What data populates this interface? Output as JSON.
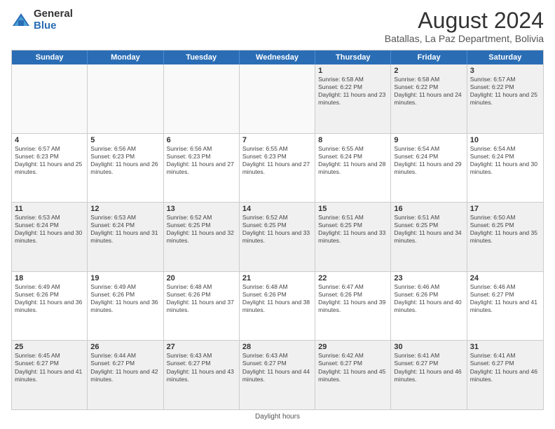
{
  "logo": {
    "general": "General",
    "blue": "Blue"
  },
  "title": "August 2024",
  "subtitle": "Batallas, La Paz Department, Bolivia",
  "days": [
    "Sunday",
    "Monday",
    "Tuesday",
    "Wednesday",
    "Thursday",
    "Friday",
    "Saturday"
  ],
  "weeks": [
    [
      {
        "day": "",
        "content": ""
      },
      {
        "day": "",
        "content": ""
      },
      {
        "day": "",
        "content": ""
      },
      {
        "day": "",
        "content": ""
      },
      {
        "day": "1",
        "content": "Sunrise: 6:58 AM\nSunset: 6:22 PM\nDaylight: 11 hours and 23 minutes."
      },
      {
        "day": "2",
        "content": "Sunrise: 6:58 AM\nSunset: 6:22 PM\nDaylight: 11 hours and 24 minutes."
      },
      {
        "day": "3",
        "content": "Sunrise: 6:57 AM\nSunset: 6:22 PM\nDaylight: 11 hours and 25 minutes."
      }
    ],
    [
      {
        "day": "4",
        "content": "Sunrise: 6:57 AM\nSunset: 6:23 PM\nDaylight: 11 hours and 25 minutes."
      },
      {
        "day": "5",
        "content": "Sunrise: 6:56 AM\nSunset: 6:23 PM\nDaylight: 11 hours and 26 minutes."
      },
      {
        "day": "6",
        "content": "Sunrise: 6:56 AM\nSunset: 6:23 PM\nDaylight: 11 hours and 27 minutes."
      },
      {
        "day": "7",
        "content": "Sunrise: 6:55 AM\nSunset: 6:23 PM\nDaylight: 11 hours and 27 minutes."
      },
      {
        "day": "8",
        "content": "Sunrise: 6:55 AM\nSunset: 6:24 PM\nDaylight: 11 hours and 28 minutes."
      },
      {
        "day": "9",
        "content": "Sunrise: 6:54 AM\nSunset: 6:24 PM\nDaylight: 11 hours and 29 minutes."
      },
      {
        "day": "10",
        "content": "Sunrise: 6:54 AM\nSunset: 6:24 PM\nDaylight: 11 hours and 30 minutes."
      }
    ],
    [
      {
        "day": "11",
        "content": "Sunrise: 6:53 AM\nSunset: 6:24 PM\nDaylight: 11 hours and 30 minutes."
      },
      {
        "day": "12",
        "content": "Sunrise: 6:53 AM\nSunset: 6:24 PM\nDaylight: 11 hours and 31 minutes."
      },
      {
        "day": "13",
        "content": "Sunrise: 6:52 AM\nSunset: 6:25 PM\nDaylight: 11 hours and 32 minutes."
      },
      {
        "day": "14",
        "content": "Sunrise: 6:52 AM\nSunset: 6:25 PM\nDaylight: 11 hours and 33 minutes."
      },
      {
        "day": "15",
        "content": "Sunrise: 6:51 AM\nSunset: 6:25 PM\nDaylight: 11 hours and 33 minutes."
      },
      {
        "day": "16",
        "content": "Sunrise: 6:51 AM\nSunset: 6:25 PM\nDaylight: 11 hours and 34 minutes."
      },
      {
        "day": "17",
        "content": "Sunrise: 6:50 AM\nSunset: 6:25 PM\nDaylight: 11 hours and 35 minutes."
      }
    ],
    [
      {
        "day": "18",
        "content": "Sunrise: 6:49 AM\nSunset: 6:26 PM\nDaylight: 11 hours and 36 minutes."
      },
      {
        "day": "19",
        "content": "Sunrise: 6:49 AM\nSunset: 6:26 PM\nDaylight: 11 hours and 36 minutes."
      },
      {
        "day": "20",
        "content": "Sunrise: 6:48 AM\nSunset: 6:26 PM\nDaylight: 11 hours and 37 minutes."
      },
      {
        "day": "21",
        "content": "Sunrise: 6:48 AM\nSunset: 6:26 PM\nDaylight: 11 hours and 38 minutes."
      },
      {
        "day": "22",
        "content": "Sunrise: 6:47 AM\nSunset: 6:26 PM\nDaylight: 11 hours and 39 minutes."
      },
      {
        "day": "23",
        "content": "Sunrise: 6:46 AM\nSunset: 6:26 PM\nDaylight: 11 hours and 40 minutes."
      },
      {
        "day": "24",
        "content": "Sunrise: 6:46 AM\nSunset: 6:27 PM\nDaylight: 11 hours and 41 minutes."
      }
    ],
    [
      {
        "day": "25",
        "content": "Sunrise: 6:45 AM\nSunset: 6:27 PM\nDaylight: 11 hours and 41 minutes."
      },
      {
        "day": "26",
        "content": "Sunrise: 6:44 AM\nSunset: 6:27 PM\nDaylight: 11 hours and 42 minutes."
      },
      {
        "day": "27",
        "content": "Sunrise: 6:43 AM\nSunset: 6:27 PM\nDaylight: 11 hours and 43 minutes."
      },
      {
        "day": "28",
        "content": "Sunrise: 6:43 AM\nSunset: 6:27 PM\nDaylight: 11 hours and 44 minutes."
      },
      {
        "day": "29",
        "content": "Sunrise: 6:42 AM\nSunset: 6:27 PM\nDaylight: 11 hours and 45 minutes."
      },
      {
        "day": "30",
        "content": "Sunrise: 6:41 AM\nSunset: 6:27 PM\nDaylight: 11 hours and 46 minutes."
      },
      {
        "day": "31",
        "content": "Sunrise: 6:41 AM\nSunset: 6:27 PM\nDaylight: 11 hours and 46 minutes."
      }
    ]
  ],
  "footer": "Daylight hours"
}
